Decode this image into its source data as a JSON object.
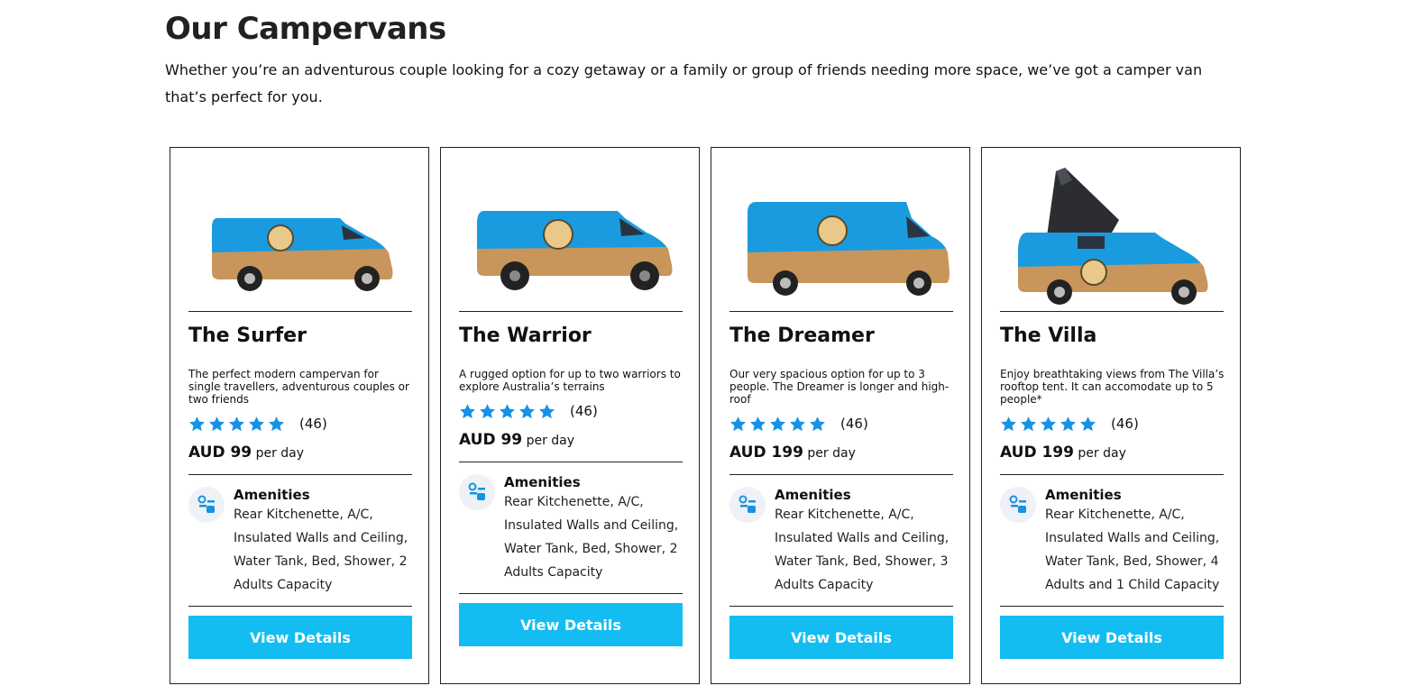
{
  "page": {
    "title": "Our Campervans",
    "intro": "Whether you’re an adventurous couple looking for a cozy getaway or a family or group of friends needing more space, we’ve got a camper van that’s perfect for you."
  },
  "colors": {
    "accent": "#13bdf2",
    "star": "#1592e6",
    "van_blue": "#1a9be0",
    "van_wood": "#c8955a"
  },
  "icons": {
    "star": "star-icon",
    "amenities": "amenities-icon"
  },
  "vans": [
    {
      "name": "The Surfer",
      "description": "The perfect modern campervan for single travellers, adventurous couples or two friends",
      "rating_stars": 5,
      "reviews": "(46)",
      "price": "AUD 99",
      "price_unit": "per day",
      "amenities_title": "Amenities",
      "amenities": "Rear Kitchenette, A/C, Insulated Walls and Ceiling, Water Tank, Bed, Shower, 2 Adults Capacity",
      "button": "View Details"
    },
    {
      "name": "The Warrior",
      "description": "A rugged option for up to two warriors to explore Australia’s terrains",
      "rating_stars": 5,
      "reviews": "(46)",
      "price": "AUD 99",
      "price_unit": "per day",
      "amenities_title": "Amenities",
      "amenities": "Rear Kitchenette, A/C, Insulated Walls and Ceiling, Water Tank, Bed, Shower, 2 Adults Capacity",
      "button": "View Details"
    },
    {
      "name": "The Dreamer",
      "description": "Our very spacious option for up to 3 people. The Dreamer is longer and high-roof",
      "rating_stars": 5,
      "reviews": "(46)",
      "price": "AUD 199",
      "price_unit": "per day",
      "amenities_title": "Amenities",
      "amenities": "Rear Kitchenette, A/C, Insulated Walls and Ceiling, Water Tank, Bed, Shower, 3 Adults Capacity",
      "button": "View Details"
    },
    {
      "name": "The Villa",
      "description": "Enjoy breathtaking views from The Villa’s rooftop tent. It can accomodate up to 5 people*",
      "rating_stars": 5,
      "reviews": "(46)",
      "price": "AUD 199",
      "price_unit": "per day",
      "amenities_title": "Amenities",
      "amenities": "Rear Kitchenette, A/C, Insulated Walls and Ceiling, Water Tank, Bed, Shower, 4 Adults and 1 Child Capacity",
      "button": "View Details"
    }
  ]
}
